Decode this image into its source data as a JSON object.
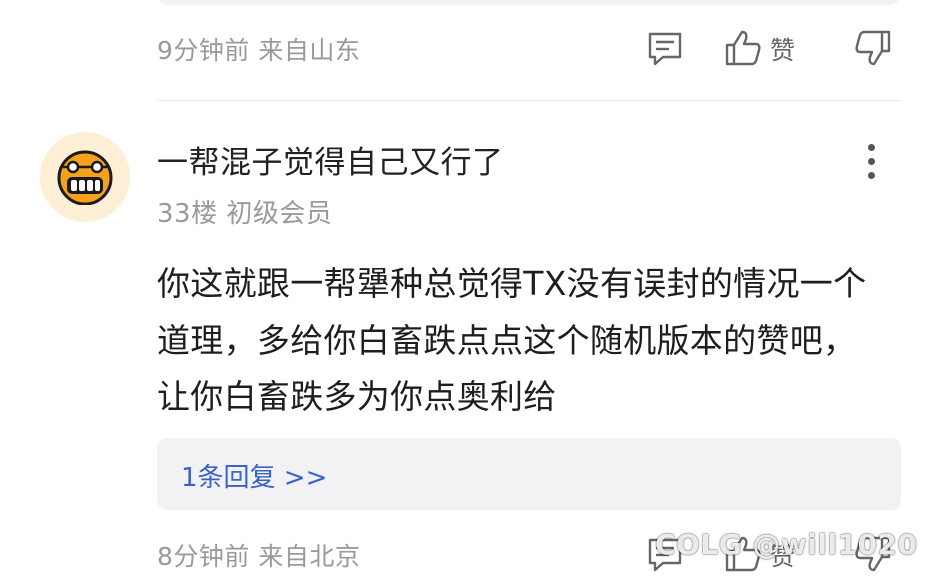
{
  "prev_comment": {
    "time": "9分钟前",
    "location": "来自山东",
    "like_label": "赞"
  },
  "comment": {
    "username": "一帮混子觉得自己又行了",
    "floor": "33楼",
    "level": "初级会员",
    "content_lines": [
      "你这就跟一帮犟种总觉得TX没有误封的情况一个",
      "道理，多给你白畜跌点点这个随机版本的赞吧，",
      "让你白畜跌多为你点奥利给"
    ],
    "reply_link": "1条回复 >>",
    "time": "8分钟前",
    "location": "来自北京",
    "like_label": "赞"
  },
  "watermark": "COLG @will1020",
  "colors": {
    "accent_link": "#3a63c7",
    "avatar_bg": "#fcefd6",
    "avatar_icon": "#f5a11b"
  },
  "icons": [
    "comment-icon",
    "thumbs-up-icon",
    "thumbs-down-icon",
    "more-icon"
  ]
}
